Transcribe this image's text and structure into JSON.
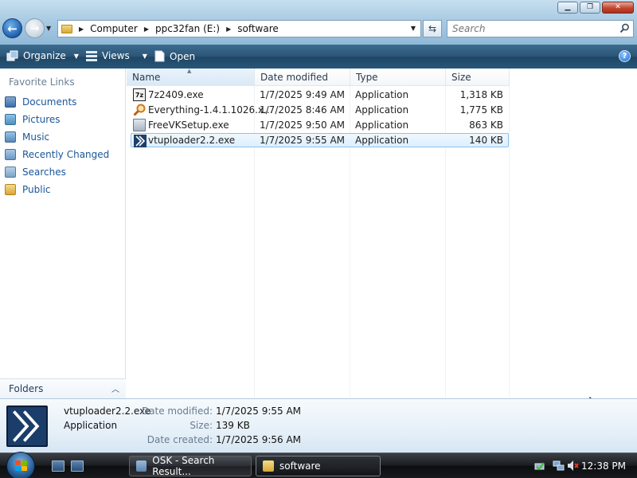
{
  "window": {
    "minimize_label": "▁",
    "maximize_label": "❐",
    "close_label": "✕"
  },
  "nav": {
    "back_label": "←",
    "forward_label": "→"
  },
  "address": {
    "crumbs": [
      "Computer",
      "ppc32fan (E:)",
      "software"
    ]
  },
  "search": {
    "placeholder": "Search"
  },
  "commands": {
    "organize": "Organize",
    "views": "Views",
    "open": "Open",
    "help": "?"
  },
  "sidebar": {
    "heading": "Favorite Links",
    "items": [
      {
        "label": "Documents",
        "icon": "documents-icon"
      },
      {
        "label": "Pictures",
        "icon": "pictures-icon"
      },
      {
        "label": "Music",
        "icon": "music-icon"
      },
      {
        "label": "Recently Changed",
        "icon": "recently-changed-icon"
      },
      {
        "label": "Searches",
        "icon": "searches-icon"
      },
      {
        "label": "Public",
        "icon": "public-folder-icon"
      }
    ],
    "folders_label": "Folders"
  },
  "file_list": {
    "columns": [
      "Name",
      "Date modified",
      "Type",
      "Size"
    ],
    "rows": [
      {
        "name": "7z2409.exe",
        "date": "1/7/2025 9:49 AM",
        "type": "Application",
        "size": "1,318 KB",
        "icon": "7zip-icon",
        "selected": false
      },
      {
        "name": "Everything-1.4.1.1026.x...",
        "date": "1/7/2025 8:46 AM",
        "type": "Application",
        "size": "1,775 KB",
        "icon": "everything-magnifier-icon",
        "selected": false
      },
      {
        "name": "FreeVKSetup.exe",
        "date": "1/7/2025 9:50 AM",
        "type": "Application",
        "size": "863 KB",
        "icon": "setup-icon",
        "selected": false
      },
      {
        "name": "vtuploader2.2.exe",
        "date": "1/7/2025 9:55 AM",
        "type": "Application",
        "size": "140 KB",
        "icon": "vtuploader-icon",
        "selected": true
      }
    ]
  },
  "details": {
    "name": "vtuploader2.2.exe",
    "type": "Application",
    "date_modified_label": "Date modified:",
    "date_modified": "1/7/2025 9:55 AM",
    "size_label": "Size:",
    "size": "139 KB",
    "date_created_label": "Date created:",
    "date_created": "1/7/2025 9:56 AM"
  },
  "taskbar": {
    "buttons": [
      {
        "label": "OSK - Search Result...",
        "active": false
      },
      {
        "label": "software",
        "active": true
      }
    ],
    "clock": "12:38 PM"
  }
}
